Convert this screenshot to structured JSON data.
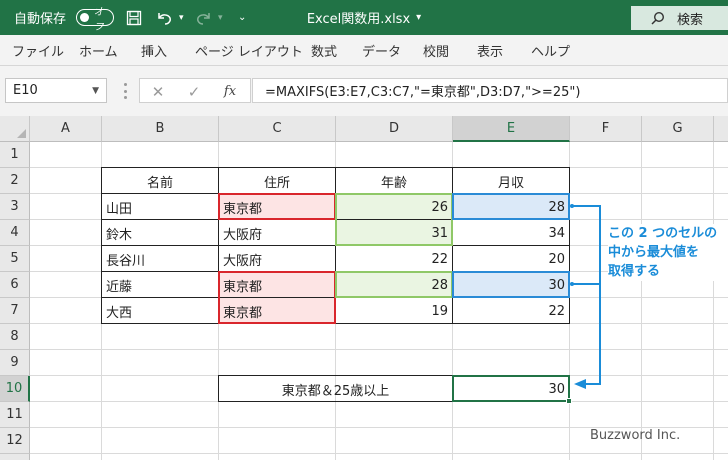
{
  "titlebar": {
    "autosave_label": "自動保存",
    "autosave_state": "オフ",
    "filename": "Excel関数用.xlsx",
    "filename_caret": "▾",
    "search_label": "検索",
    "accent": "#217346"
  },
  "menu": [
    "ファイル",
    "ホーム",
    "挿入",
    "ページ レイアウト",
    "数式",
    "データ",
    "校閲",
    "表示",
    "ヘルプ"
  ],
  "formula_bar": {
    "name_box": "E10",
    "fx_label": "fx",
    "formula": "=MAXIFS(E3:E7,C3:C7,\"=東京都\",D3:D7,\">=25\")"
  },
  "columns": [
    "A",
    "B",
    "C",
    "D",
    "E",
    "F",
    "G"
  ],
  "rows": [
    "1",
    "2",
    "3",
    "4",
    "5",
    "6",
    "7",
    "8",
    "9",
    "10",
    "11",
    "12"
  ],
  "table": {
    "headers": [
      "名前",
      "住所",
      "年齢",
      "月収"
    ],
    "records": [
      {
        "name": "山田",
        "address": "東京都",
        "age": "26",
        "income": "28"
      },
      {
        "name": "鈴木",
        "address": "大阪府",
        "age": "31",
        "income": "34"
      },
      {
        "name": "長谷川",
        "address": "大阪府",
        "age": "22",
        "income": "20"
      },
      {
        "name": "近藤",
        "address": "東京都",
        "age": "28",
        "income": "30"
      },
      {
        "name": "大西",
        "address": "東京都",
        "age": "19",
        "income": "22"
      }
    ]
  },
  "result": {
    "label": "東京都＆25歳以上",
    "value": "30"
  },
  "annotation": [
    "この 2 つのセルの",
    "中から最大値を",
    "取得する"
  ],
  "watermark": "Buzzword Inc.",
  "colors": {
    "red_highlight": "#d9262c",
    "green_highlight": "#8fc867",
    "blue_highlight": "#2a8bd6"
  }
}
